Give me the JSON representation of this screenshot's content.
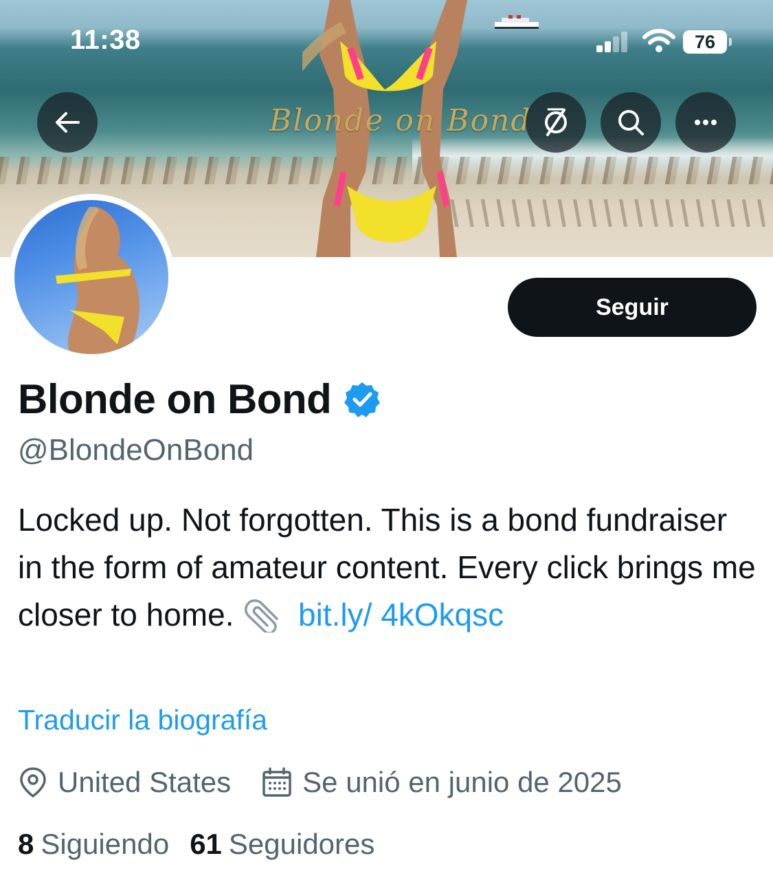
{
  "status_bar": {
    "time": "11:38",
    "battery": "76"
  },
  "banner": {
    "watermark": "Blonde on Bond",
    "buttons": [
      "arrow-left-icon",
      "incognito-icon",
      "search-icon",
      "more-icon"
    ]
  },
  "profile": {
    "display_name": "Blonde on Bond",
    "verified": true,
    "handle": "@BlondeOnBond",
    "follow_label": "Seguir",
    "bio_text": "Locked up. Not forgotten. This is a bond fundraiser in the form of amateur content. Every click brings me closer to home.",
    "bio_link": "bit.ly/ 4kOkqsc",
    "translate_label": "Traducir la biografía",
    "location": "United States",
    "joined": "Se unió en junio de 2025",
    "following_count": "8",
    "following_label": "Siguiendo",
    "followers_count": "61",
    "followers_label": "Seguidores"
  },
  "colors": {
    "accent": "#1d9bf0",
    "text_primary": "#0f1419",
    "text_secondary": "#536471",
    "button_dark": "#0f1419"
  }
}
